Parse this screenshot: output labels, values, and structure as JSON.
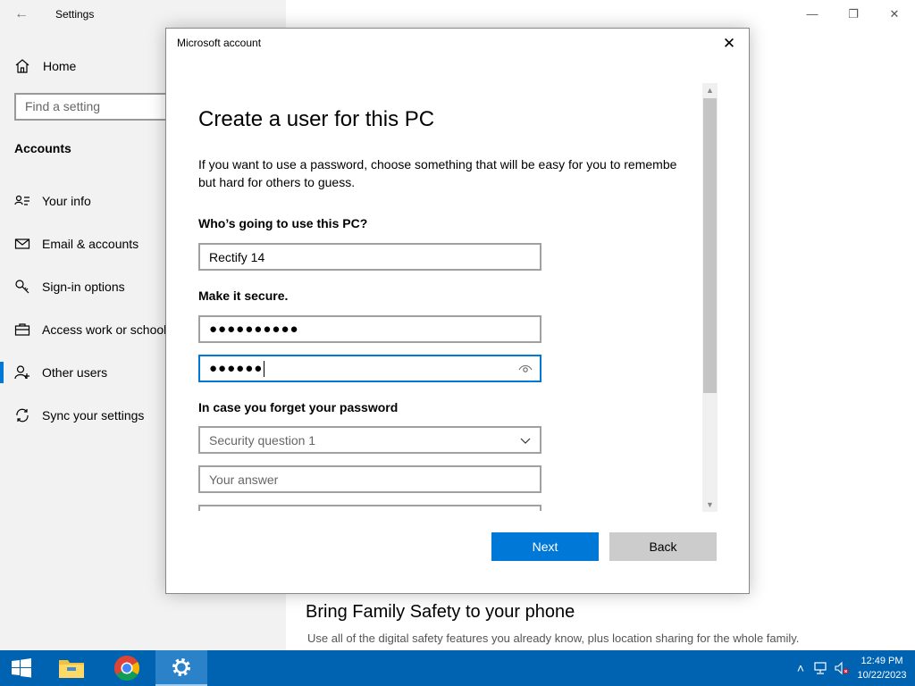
{
  "settings": {
    "title": "Settings",
    "home": "Home",
    "search_placeholder": "Find a setting",
    "section": "Accounts",
    "nav": [
      {
        "label": "Your info",
        "icon": "person-card-icon"
      },
      {
        "label": "Email & accounts",
        "icon": "mail-icon"
      },
      {
        "label": "Sign-in options",
        "icon": "key-icon"
      },
      {
        "label": "Access work or school",
        "icon": "briefcase-icon"
      },
      {
        "label": "Other users",
        "icon": "person-add-icon"
      },
      {
        "label": "Sync your settings",
        "icon": "sync-icon"
      }
    ],
    "family_heading": "Bring Family Safety to your phone",
    "family_desc": "Use all of the digital safety features you already know, plus location sharing for the whole family."
  },
  "dialog": {
    "title": "Microsoft account",
    "heading": "Create a user for this PC",
    "intro_line1": "If you want to use a password, choose something that will be easy for you to remembe",
    "intro_line2": "but hard for others to guess.",
    "who_label": "Who’s going to use this PC?",
    "username_value": "Rectify 14",
    "secure_label": "Make it secure.",
    "password_value": "●●●●●●●●●●",
    "confirm_value": "●●●●●●",
    "forget_label": "In case you forget your password",
    "security_question": "Security question 1",
    "answer_placeholder": "Your answer",
    "next": "Next",
    "back": "Back"
  },
  "taskbar": {
    "time": "12:49 PM",
    "date": "10/22/2023"
  },
  "colors": {
    "accent": "#0078d7",
    "taskbar": "#0063b1"
  }
}
